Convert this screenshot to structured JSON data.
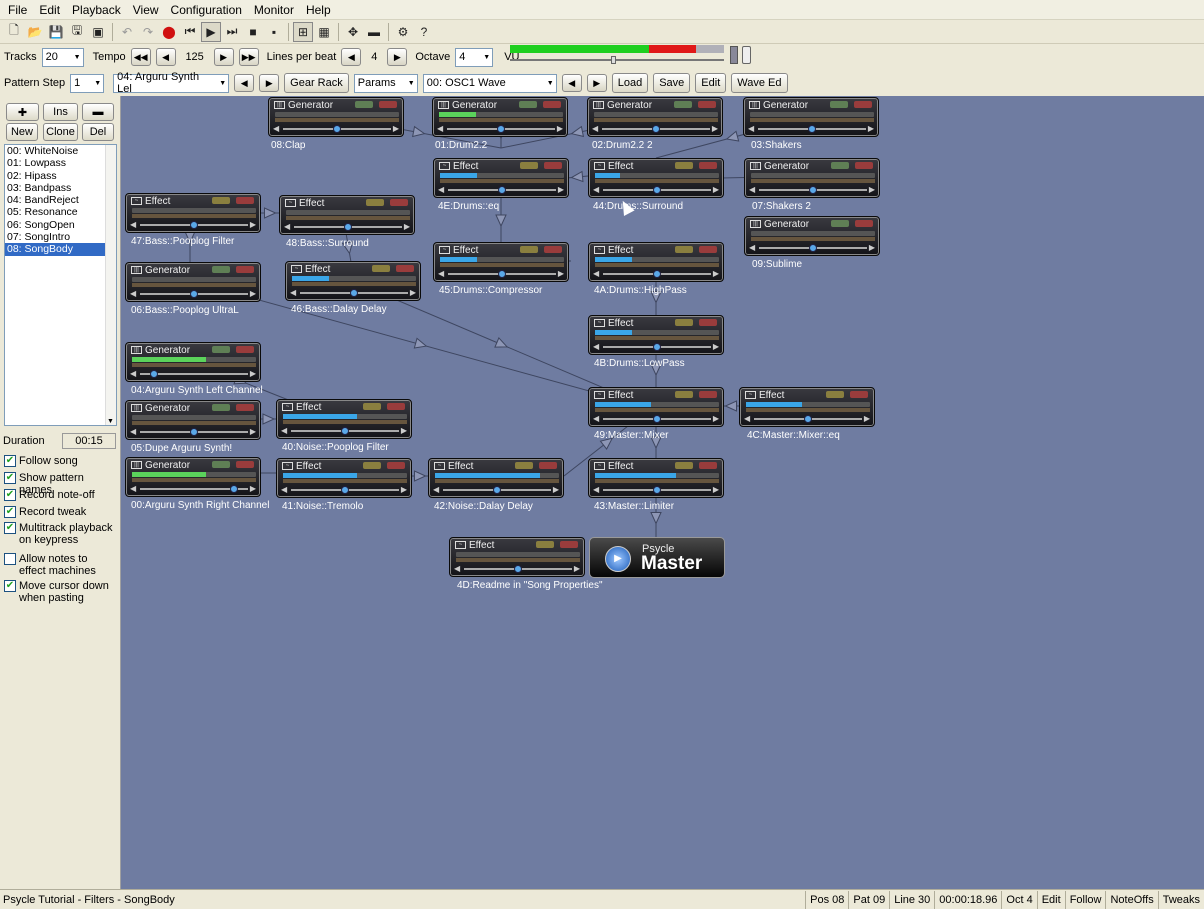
{
  "menu": [
    "File",
    "Edit",
    "Playback",
    "View",
    "Configuration",
    "Monitor",
    "Help"
  ],
  "toolbar_icons": [
    "new-file-icon",
    "open-folder-icon",
    "save-icon",
    "save-as-icon",
    "render-icon",
    "undo-icon",
    "redo-icon",
    "record-icon",
    "play-from-start-icon",
    "play-icon",
    "play-selection-icon",
    "stop-icon",
    "block-icon",
    "machine-view-icon",
    "pattern-view-icon",
    "sequence-icon",
    "wave-editor-icon",
    "settings-icon",
    "help-icon"
  ],
  "row1": {
    "tracks_label": "Tracks",
    "tracks_value": "20",
    "tempo_label": "Tempo",
    "tempo_value": "125",
    "lpb_label": "Lines per beat",
    "lpb_value": "4",
    "octave_label": "Octave",
    "octave_value": "4",
    "vu_label": "VU",
    "vu_green": 0.65,
    "vu_red": 0.22
  },
  "row2": {
    "step_label": "Pattern Step",
    "step_value": "1",
    "machine_select": "04: Arguru Synth Lel",
    "gear_rack": "Gear Rack",
    "params": "Params",
    "wave_select": "00:  OSC1 Wave",
    "load": "Load",
    "save": "Save",
    "edit": "Edit",
    "wave_ed": "Wave Ed"
  },
  "sidebar": {
    "btn_add": "✚",
    "btn_ins": "Ins",
    "btn_remove": "▬",
    "btn_new": "New",
    "btn_clone": "Clone",
    "btn_del": "Del",
    "patterns": [
      "00: WhiteNoise",
      "01: Lowpass",
      "02: Hipass",
      "03: Bandpass",
      "04: BandReject",
      "05: Resonance",
      "06: SongOpen",
      "07: SongIntro",
      "08: SongBody"
    ],
    "selected_index": 8,
    "duration_label": "Duration",
    "duration_value": "00:15",
    "options": [
      {
        "label": "Follow song",
        "checked": true
      },
      {
        "label": "Show pattern names",
        "checked": true
      },
      {
        "label": "Record note-off",
        "checked": true
      },
      {
        "label": "Record tweak",
        "checked": true
      },
      {
        "label": "Multitrack playback on keypress",
        "checked": true
      },
      {
        "label": "Allow notes to effect machines",
        "checked": false
      },
      {
        "label": "Move cursor down when pasting",
        "checked": true
      }
    ]
  },
  "machines": [
    {
      "type": "Generator",
      "name": "08:Clap",
      "level": 0.0,
      "pan": 0.5
    },
    {
      "type": "Generator",
      "name": "01:Drum2.2",
      "level": 0.3,
      "pan": 0.5
    },
    {
      "type": "Generator",
      "name": "02:Drum2.2 2",
      "level": 0.0,
      "pan": 0.5
    },
    {
      "type": "Generator",
      "name": "03:Shakers",
      "level": 0.0,
      "pan": 0.5
    },
    {
      "type": "Effect",
      "name": "4E:Drums::eq",
      "level": 0.3,
      "pan": 0.5
    },
    {
      "type": "Effect",
      "name": "44:Drums::Surround",
      "level": 0.2,
      "pan": 0.5
    },
    {
      "type": "Generator",
      "name": "07:Shakers 2",
      "level": 0.0,
      "pan": 0.5
    },
    {
      "type": "Effect",
      "name": "47:Bass::Pooplog Filter",
      "level": 0.0,
      "pan": 0.5
    },
    {
      "type": "Effect",
      "name": "48:Bass::Surround",
      "level": 0.0,
      "pan": 0.5
    },
    {
      "type": "Generator",
      "name": "09:Sublime",
      "level": 0.0,
      "pan": 0.5
    },
    {
      "type": "Generator",
      "name": "06:Bass::Pooplog UltraL",
      "level": 0.0,
      "pan": 0.5
    },
    {
      "type": "Effect",
      "name": "46:Bass::Dalay Delay",
      "level": 0.3,
      "pan": 0.5
    },
    {
      "type": "Effect",
      "name": "45:Drums::Compressor",
      "level": 0.3,
      "pan": 0.5
    },
    {
      "type": "Effect",
      "name": "4A:Drums::HighPass",
      "level": 0.3,
      "pan": 0.5
    },
    {
      "type": "Effect",
      "name": "4B:Drums::LowPass",
      "level": 0.3,
      "pan": 0.5
    },
    {
      "type": "Generator",
      "name": "04:Arguru Synth Left Channel",
      "level": 0.6,
      "pan": 0.1
    },
    {
      "type": "Generator",
      "name": "05:Dupe Arguru Synth!",
      "level": 0.0,
      "pan": 0.5
    },
    {
      "type": "Effect",
      "name": "40:Noise::Pooplog Filter",
      "level": 0.6,
      "pan": 0.5
    },
    {
      "type": "Effect",
      "name": "49:Master::Mixer",
      "level": 0.45,
      "pan": 0.5
    },
    {
      "type": "Effect",
      "name": "4C:Master::Mixer::eq",
      "level": 0.45,
      "pan": 0.5
    },
    {
      "type": "Generator",
      "name": "00:Arguru Synth Right Channel",
      "level": 0.6,
      "pan": 0.9
    },
    {
      "type": "Effect",
      "name": "41:Noise::Tremolo",
      "level": 0.6,
      "pan": 0.5
    },
    {
      "type": "Effect",
      "name": "42:Noise::Dalay Delay",
      "level": 0.85,
      "pan": 0.5
    },
    {
      "type": "Effect",
      "name": "43:Master::Limiter",
      "level": 0.65,
      "pan": 0.5
    },
    {
      "type": "Effect",
      "name": "4D:Readme in \"Song Properties\"",
      "level": 0.0,
      "pan": 0.5
    }
  ],
  "master": {
    "line1": "Psycle",
    "line2": "Master"
  },
  "status": {
    "title": "Psycle Tutorial - Filters - SongBody",
    "panes": [
      "Pos 08",
      "Pat 09",
      "Line 30",
      "00:00:18.96",
      "Oct 4",
      "Edit",
      "Follow",
      "NoteOffs",
      "Tweaks"
    ]
  },
  "colors": {
    "canvas": "#6f7ca1",
    "generator_meter": "#5bd35b",
    "effect_meter": "#3aa6e8",
    "selection": "#316ac5"
  }
}
